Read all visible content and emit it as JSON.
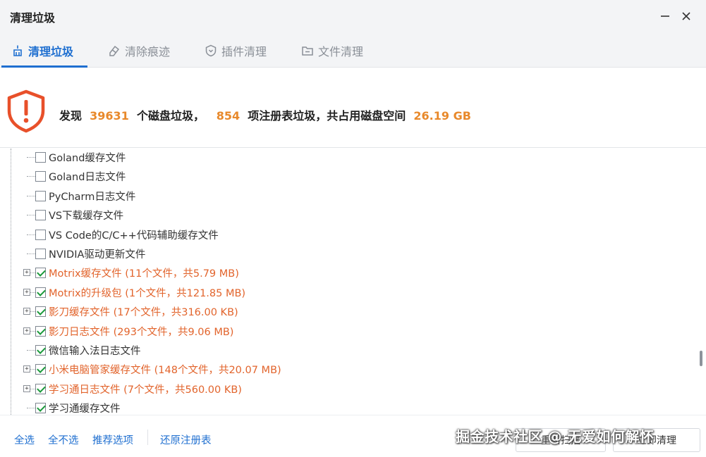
{
  "window": {
    "title": "清理垃圾"
  },
  "tabs": [
    {
      "label": "清理垃圾",
      "icon": "broom-icon",
      "active": true
    },
    {
      "label": "清除痕迹",
      "icon": "eraser-icon",
      "active": false
    },
    {
      "label": "插件清理",
      "icon": "shield-plugin-icon",
      "active": false
    },
    {
      "label": "文件清理",
      "icon": "folder-icon",
      "active": false
    }
  ],
  "summary": {
    "prefix": "发现",
    "disk_count": "39631",
    "disk_label": "个磁盘垃圾，",
    "registry_count": "854",
    "registry_label": "项注册表垃圾，共占用磁盘空间",
    "size": "26.19 GB",
    "icon": "warning-shield-icon"
  },
  "tree": {
    "items": [
      {
        "label": "Goland缓存文件",
        "checked": false,
        "expandable": false,
        "highlight": false
      },
      {
        "label": "Goland日志文件",
        "checked": false,
        "expandable": false,
        "highlight": false
      },
      {
        "label": "PyCharm日志文件",
        "checked": false,
        "expandable": false,
        "highlight": false
      },
      {
        "label": "VS下载缓存文件",
        "checked": false,
        "expandable": false,
        "highlight": false
      },
      {
        "label": "VS Code的C/C++代码辅助缓存文件",
        "checked": false,
        "expandable": false,
        "highlight": false
      },
      {
        "label": "NVIDIA驱动更新文件",
        "checked": false,
        "expandable": false,
        "highlight": false
      },
      {
        "label": "Motrix缓存文件 (11个文件，共5.79 MB)",
        "checked": true,
        "expandable": true,
        "highlight": true
      },
      {
        "label": "Motrix的升级包 (1个文件，共121.85 MB)",
        "checked": true,
        "expandable": true,
        "highlight": true
      },
      {
        "label": "影刀缓存文件 (17个文件，共316.00 KB)",
        "checked": true,
        "expandable": true,
        "highlight": true
      },
      {
        "label": "影刀日志文件 (293个文件，共9.06 MB)",
        "checked": true,
        "expandable": true,
        "highlight": true
      },
      {
        "label": "微信输入法日志文件",
        "checked": true,
        "expandable": false,
        "highlight": false
      },
      {
        "label": "小米电脑管家缓存文件 (148个文件，共20.07 MB)",
        "checked": true,
        "expandable": true,
        "highlight": true
      },
      {
        "label": "学习通日志文件 (7个文件，共560.00 KB)",
        "checked": true,
        "expandable": true,
        "highlight": true
      },
      {
        "label": "学习通缓存文件",
        "checked": true,
        "expandable": false,
        "highlight": false
      }
    ]
  },
  "footer": {
    "select_all": "全选",
    "select_none": "全不选",
    "recommended": "推荐选项",
    "restore_registry": "还原注册表",
    "rescan": "重新扫描",
    "clean": "立即清理",
    "watermark": "掘金技术社区 @ 无爱如何解怀"
  },
  "colors": {
    "accent": "#1f6fd0",
    "highlight_text": "#e2642c",
    "stat_number": "#e8892b",
    "warning_icon": "#e8502a",
    "check": "#1a9a3a"
  }
}
